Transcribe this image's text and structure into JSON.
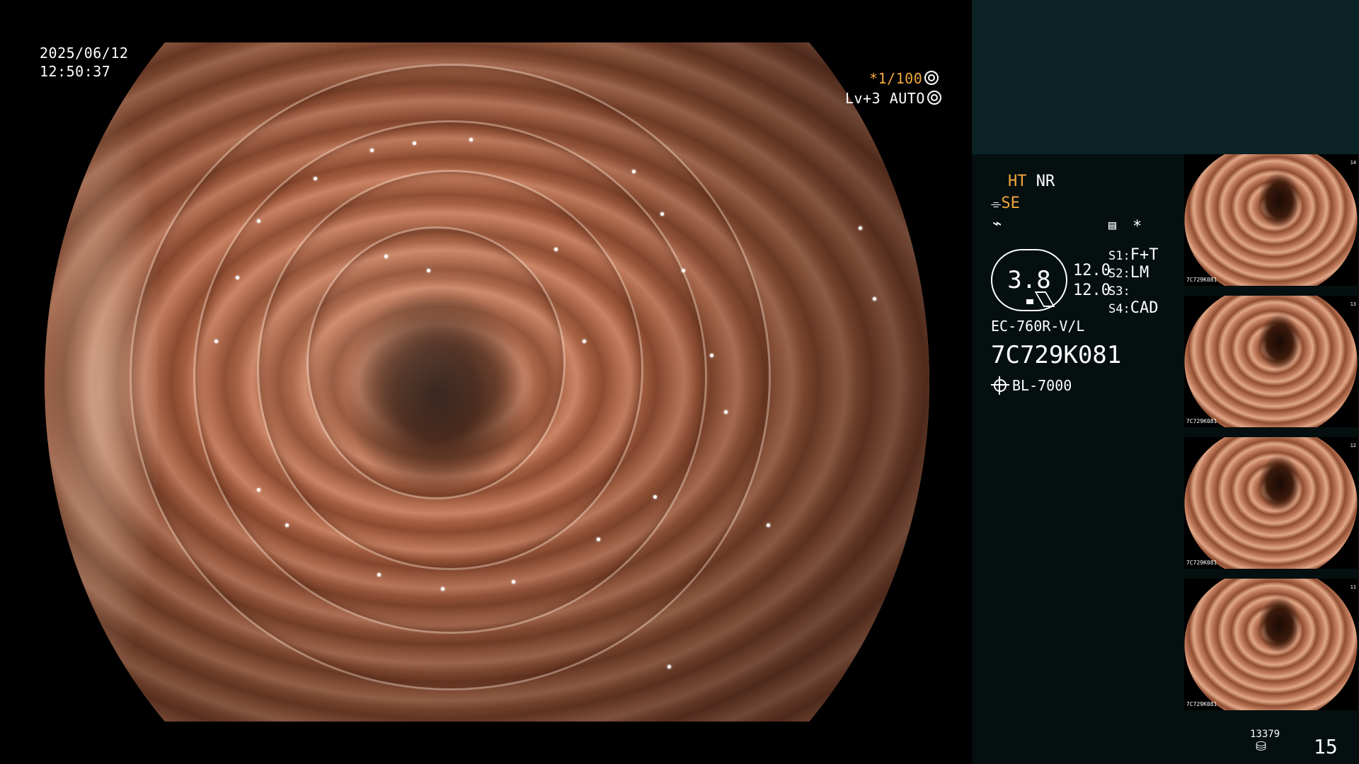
{
  "overlay": {
    "date": "2025/06/12",
    "time": "12:50:37",
    "shutter": "*1/100",
    "level": "Lv+3",
    "mode": "AUTO",
    "shutter_icon": "aperture-icon",
    "mode_icon": "target-icon"
  },
  "panel": {
    "ht": "HT",
    "nr": "NR",
    "se": "SE",
    "se_icon": "scope-tip-icon",
    "freeze_icon": "lightning-icon",
    "settings_icon": "menu-box-icon",
    "asterisk": "*",
    "scale_value": "3.8",
    "val_a": "12.0",
    "val_b": "12.0",
    "s1_key": "S1:",
    "s1_val": "F+T",
    "s2_key": "S2:",
    "s2_val": "LM",
    "s3_key": "S3:",
    "s3_val": "",
    "s4_key": "S4:",
    "s4_val": "CAD",
    "scope_model": "EC-760R-V/L",
    "scope_serial": "7C729K081",
    "light_icon": "light-source-icon",
    "light_source": "BL-7000",
    "storage_count": "13379",
    "storage_icon": "disk-icon",
    "image_count": "15"
  },
  "thumbnails": [
    {
      "code": "7C729K081",
      "num": "14"
    },
    {
      "code": "7C729K081",
      "num": "13"
    },
    {
      "code": "7C729K081",
      "num": "12"
    },
    {
      "code": "7C729K081",
      "num": "11"
    }
  ],
  "colors": {
    "accent_orange": "#f2a73b",
    "panel_top": "#0b2325",
    "panel_bg": "#050f10"
  }
}
